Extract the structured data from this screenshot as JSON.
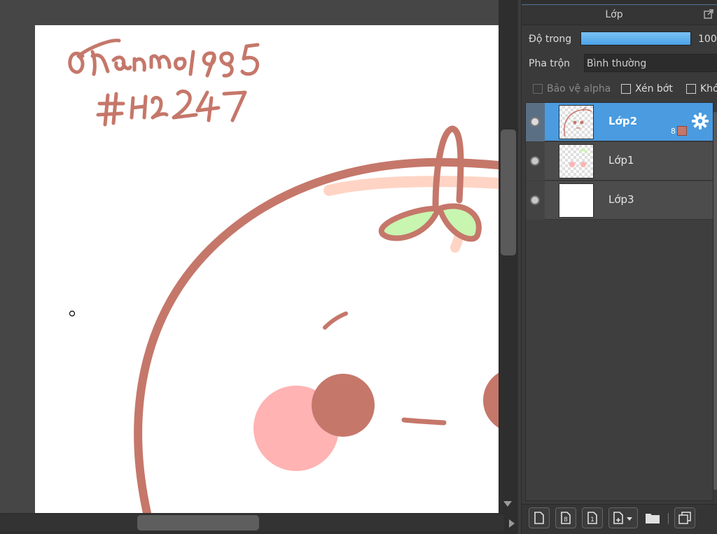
{
  "panel": {
    "title": "Lớp",
    "opacity_label": "Độ trong",
    "opacity_value": "100",
    "opacity_percent": 100,
    "blend_label": "Pha trộn",
    "blend_value": "Bình thường",
    "checkboxes": [
      {
        "label": "Bảo vệ alpha",
        "checked": false,
        "enabled": false
      },
      {
        "label": "Xén bớt",
        "checked": false,
        "enabled": true
      },
      {
        "label": "Khó",
        "checked": false,
        "enabled": true
      }
    ],
    "layers": [
      {
        "name": "Lớp2",
        "selected": true,
        "visible": true,
        "count": "8",
        "swatch_color": "#c5776a"
      },
      {
        "name": "Lớp1",
        "selected": false,
        "visible": true
      },
      {
        "name": "Lớp3",
        "selected": false,
        "visible": true
      }
    ],
    "toolbar": [
      "new-layer-icon",
      "new-8bit-layer-icon",
      "new-1bit-layer-icon",
      "add-layer-menu-icon",
      "folder-icon",
      "duplicate-layer-icon"
    ]
  },
  "canvas": {
    "signature_line1": "@tranmo1985",
    "signature_line2": "#HD247",
    "stroke_color": "#c5776a",
    "leaf_color": "#c8f5b0",
    "blush_color": "#ffb3b3",
    "paper_color": "#ffffff"
  },
  "colors": {
    "accent": "#4a9be0",
    "opacity_bar": "#5aaeea",
    "background": "#3c3c3c"
  }
}
